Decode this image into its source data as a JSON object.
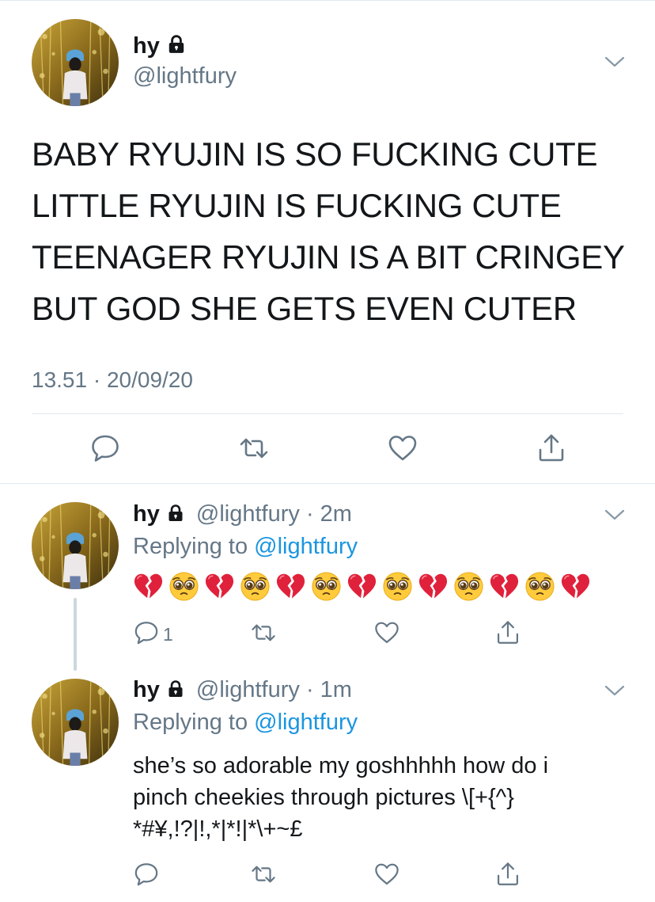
{
  "main_tweet": {
    "name": "hy",
    "handle": "@lightfury",
    "lines": [
      "BABY RYUJIN IS SO FUCKING CUTE",
      "LITTLE RYUJIN IS FUCKING CUTE",
      "TEENAGER RYUJIN IS A BIT CRINGEY",
      "BUT GOD SHE GETS EVEN CUTER"
    ],
    "timestamp": "13.51 · 20/09/20"
  },
  "reply1": {
    "name": "hy",
    "handle": "@lightfury",
    "time": "· 2m",
    "replying_prefix": "Replying to ",
    "replying_to": "@lightfury",
    "emojis": [
      "broken-heart",
      "pleading-face",
      "broken-heart",
      "pleading-face",
      "broken-heart",
      "pleading-face",
      "broken-heart",
      "pleading-face",
      "broken-heart",
      "pleading-face",
      "broken-heart",
      "pleading-face",
      "broken-heart"
    ],
    "reply_count": "1"
  },
  "reply2": {
    "name": "hy",
    "handle": "@lightfury",
    "time": "· 1m",
    "replying_prefix": "Replying to ",
    "replying_to": "@lightfury",
    "lines": [
      "she’s so adorable my goshhhhh how do i",
      "pinch cheekies through pictures \\[+{^}",
      "*#¥,!?|!,*|*!|*\\+~£"
    ]
  },
  "colors": {
    "text": "#14171a",
    "secondary": "#657786",
    "link": "#1b95e0",
    "divider": "#e1e8ed",
    "thread_line": "#ccd6dd"
  },
  "icons": [
    "lock-icon",
    "chevron-down-icon",
    "reply-icon",
    "retweet-icon",
    "like-icon",
    "share-icon",
    "broken-heart-emoji",
    "pleading-face-emoji"
  ]
}
